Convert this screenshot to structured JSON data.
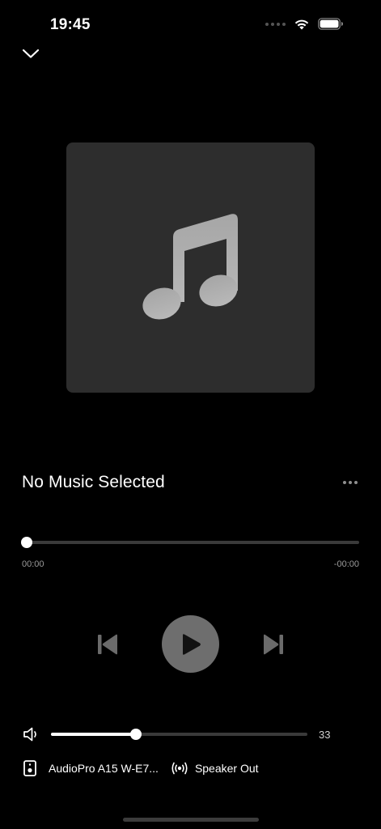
{
  "status_bar": {
    "time": "19:45"
  },
  "player": {
    "track_title": "No Music Selected",
    "progress": {
      "fraction": 0,
      "elapsed": "00:00",
      "remaining": "-00:00"
    },
    "volume": {
      "value": "33",
      "fraction": 0.33
    },
    "device": {
      "name": "AudioPro A15 W-E7...",
      "output": "Speaker Out"
    }
  },
  "colors": {
    "background": "#000000",
    "artwork_bg": "#2d2d2d",
    "note_gray": "#a9a9a9",
    "play_button": "#6e6e6e",
    "disabled_control": "#6b6b6b"
  },
  "icons": [
    "chevron-down-icon",
    "music-note-icon",
    "more-icon",
    "previous-icon",
    "play-icon",
    "next-icon",
    "volume-icon",
    "speaker-device-icon",
    "broadcast-icon",
    "wifi-icon",
    "battery-icon"
  ]
}
